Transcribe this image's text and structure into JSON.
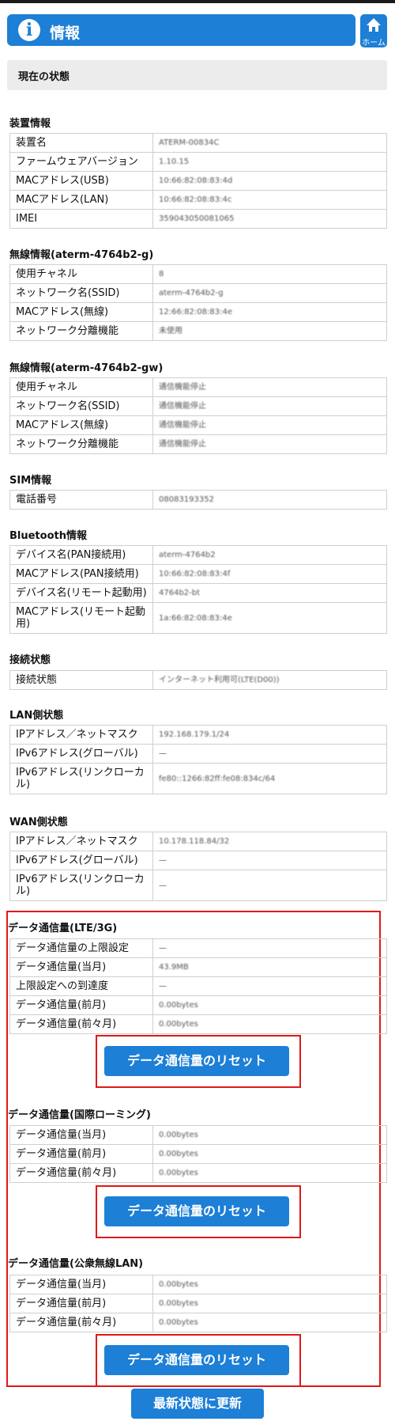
{
  "header": {
    "title": "情報",
    "home_label": "ホーム"
  },
  "status_title": "現在の状態",
  "device": {
    "title": "装置情報",
    "rows": [
      {
        "k": "装置名",
        "v": "ATERM-00834C"
      },
      {
        "k": "ファームウェアバージョン",
        "v": "1.10.15"
      },
      {
        "k": "MACアドレス(USB)",
        "v": "10:66:82:08:83:4d"
      },
      {
        "k": "MACアドレス(LAN)",
        "v": "10:66:82:08:83:4c"
      },
      {
        "k": "IMEI",
        "v": "359043050081065"
      }
    ]
  },
  "wireless_g": {
    "title": "無線情報(aterm-4764b2-g)",
    "rows": [
      {
        "k": "使用チャネル",
        "v": "8"
      },
      {
        "k": "ネットワーク名(SSID)",
        "v": "aterm-4764b2-g"
      },
      {
        "k": "MACアドレス(無線)",
        "v": "12:66:82:08:83:4e"
      },
      {
        "k": "ネットワーク分離機能",
        "v": "未使用"
      }
    ]
  },
  "wireless_gw": {
    "title": "無線情報(aterm-4764b2-gw)",
    "rows": [
      {
        "k": "使用チャネル",
        "v": "通信機能停止"
      },
      {
        "k": "ネットワーク名(SSID)",
        "v": "通信機能停止"
      },
      {
        "k": "MACアドレス(無線)",
        "v": "通信機能停止"
      },
      {
        "k": "ネットワーク分離機能",
        "v": "通信機能停止"
      }
    ]
  },
  "sim": {
    "title": "SIM情報",
    "rows": [
      {
        "k": "電話番号",
        "v": "08083193352"
      }
    ]
  },
  "bluetooth": {
    "title": "Bluetooth情報",
    "rows": [
      {
        "k": "デバイス名(PAN接続用)",
        "v": "aterm-4764b2"
      },
      {
        "k": "MACアドレス(PAN接続用)",
        "v": "10:66:82:08:83:4f"
      },
      {
        "k": "デバイス名(リモート起動用)",
        "v": "4764b2-bt"
      },
      {
        "k": "MACアドレス(リモート起動用)",
        "v": "1a:66:82:08:83:4e"
      }
    ]
  },
  "connection": {
    "title": "接続状態",
    "rows": [
      {
        "k": "接続状態",
        "v": "インターネット利用可(LTE(D00))"
      }
    ]
  },
  "lan": {
    "title": "LAN側状態",
    "rows": [
      {
        "k": "IPアドレス／ネットマスク",
        "v": "192.168.179.1/24"
      },
      {
        "k": "IPv6アドレス(グローバル)",
        "v": "—"
      },
      {
        "k": "IPv6アドレス(リンクローカル)",
        "v": "fe80::1266:82ff:fe08:834c/64"
      }
    ]
  },
  "wan": {
    "title": "WAN側状態",
    "rows": [
      {
        "k": "IPアドレス／ネットマスク",
        "v": "10.178.118.84/32"
      },
      {
        "k": "IPv6アドレス(グローバル)",
        "v": "—"
      },
      {
        "k": "IPv6アドレス(リンクローカル)",
        "v": "—"
      }
    ]
  },
  "data_lte": {
    "title": "データ通信量(LTE/3G)",
    "rows": [
      {
        "k": "データ通信量の上限設定",
        "v": "—"
      },
      {
        "k": "データ通信量(当月)",
        "v": "43.9MB"
      },
      {
        "k": "上限設定への到達度",
        "v": "—"
      },
      {
        "k": "データ通信量(前月)",
        "v": "0.00bytes"
      },
      {
        "k": "データ通信量(前々月)",
        "v": "0.00bytes"
      }
    ]
  },
  "data_roaming": {
    "title": "データ通信量(国際ローミング)",
    "rows": [
      {
        "k": "データ通信量(当月)",
        "v": "0.00bytes"
      },
      {
        "k": "データ通信量(前月)",
        "v": "0.00bytes"
      },
      {
        "k": "データ通信量(前々月)",
        "v": "0.00bytes"
      }
    ]
  },
  "data_wlan": {
    "title": "データ通信量(公衆無線LAN)",
    "rows": [
      {
        "k": "データ通信量(当月)",
        "v": "0.00bytes"
      },
      {
        "k": "データ通信量(前月)",
        "v": "0.00bytes"
      },
      {
        "k": "データ通信量(前々月)",
        "v": "0.00bytes"
      }
    ]
  },
  "reset_label": "データ通信量のリセット",
  "refresh_label": "最新状態に更新"
}
